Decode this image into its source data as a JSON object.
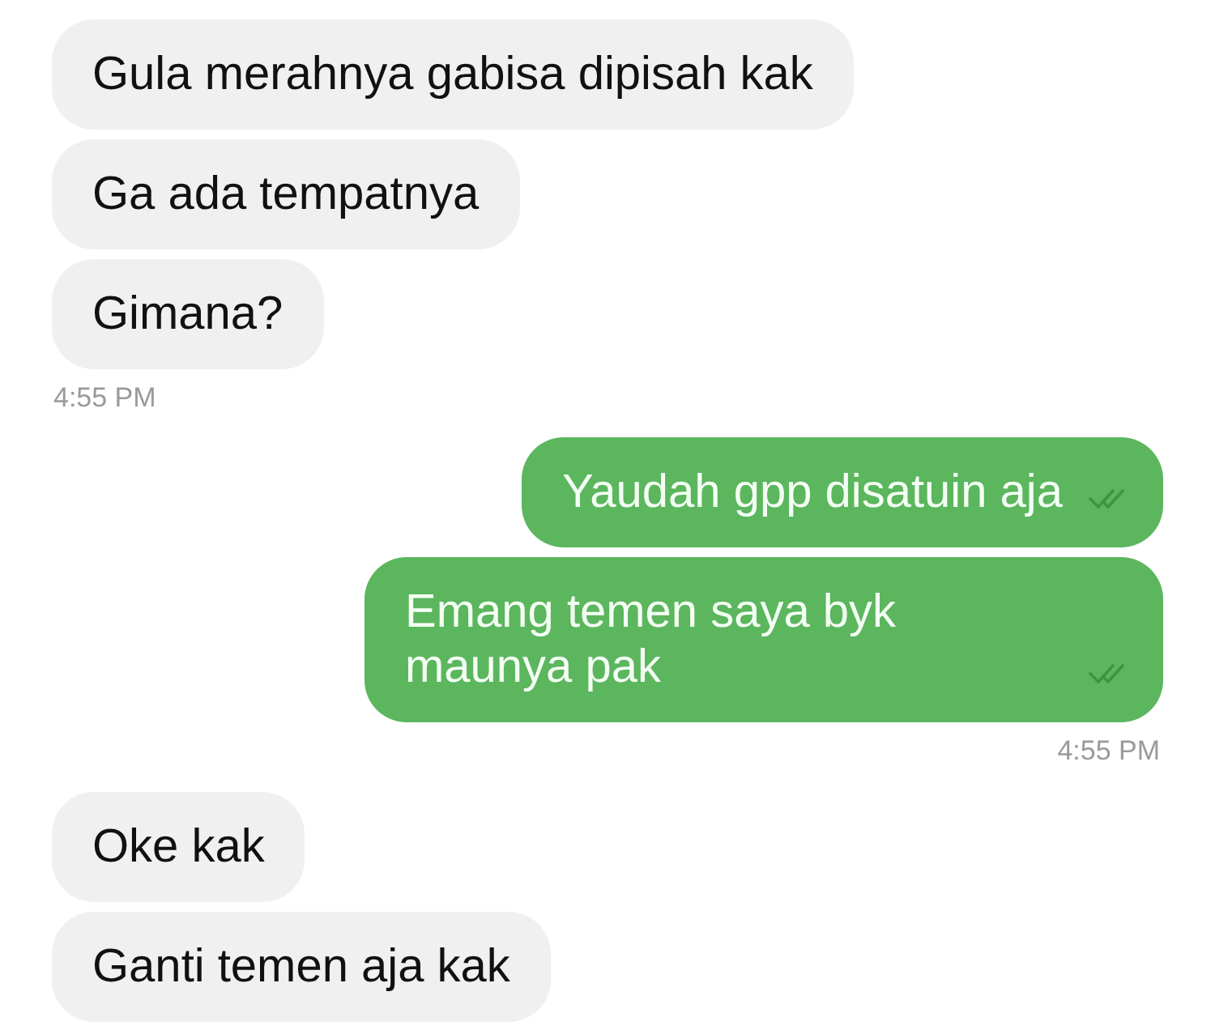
{
  "groups": [
    {
      "kind": "incoming",
      "messages": [
        "Gula merahnya gabisa dipisah kak",
        "Ga ada tempatnya",
        "Gimana?"
      ],
      "time": "4:55 PM"
    },
    {
      "kind": "outgoing",
      "messages": [
        "Yaudah gpp disatuin aja",
        "Emang temen saya byk maunya pak"
      ],
      "time": "4:55 PM"
    },
    {
      "kind": "incoming",
      "messages": [
        "Oke kak",
        "Ganti temen aja kak"
      ]
    }
  ]
}
